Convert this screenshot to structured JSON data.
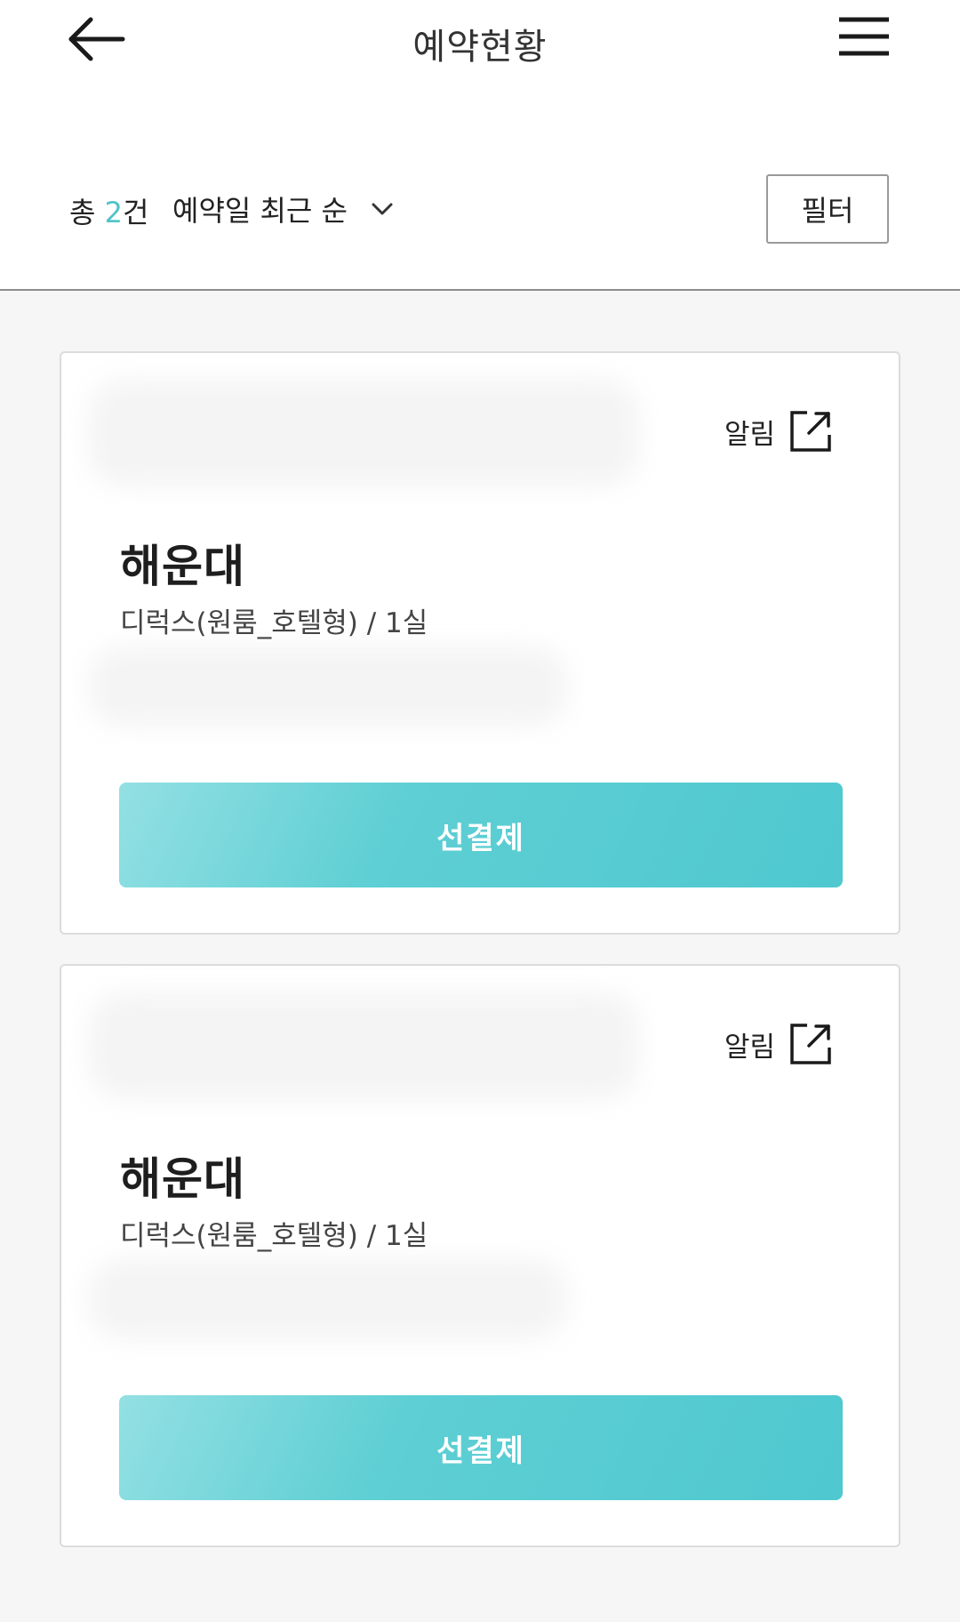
{
  "header": {
    "title": "예약현황",
    "back_icon": "arrow-left-icon",
    "menu_icon": "hamburger-menu-icon"
  },
  "summary": {
    "total_prefix": "총 ",
    "total_count": "2",
    "total_suffix": "건",
    "sort_label": "예약일 최근 순",
    "sort_icon": "chevron-down-icon",
    "filter_label": "필터"
  },
  "colors": {
    "accent": "#4fc3c9",
    "button": "#52c9cf"
  },
  "reservations": [
    {
      "alert_label": "알림",
      "alert_icon": "external-link-icon",
      "place": "해운대",
      "room": "디럭스(원룸_호텔형) / 1실",
      "pay_label": "선결제"
    },
    {
      "alert_label": "알림",
      "alert_icon": "external-link-icon",
      "place": "해운대",
      "room": "디럭스(원룸_호텔형) / 1실",
      "pay_label": "선결제"
    }
  ]
}
